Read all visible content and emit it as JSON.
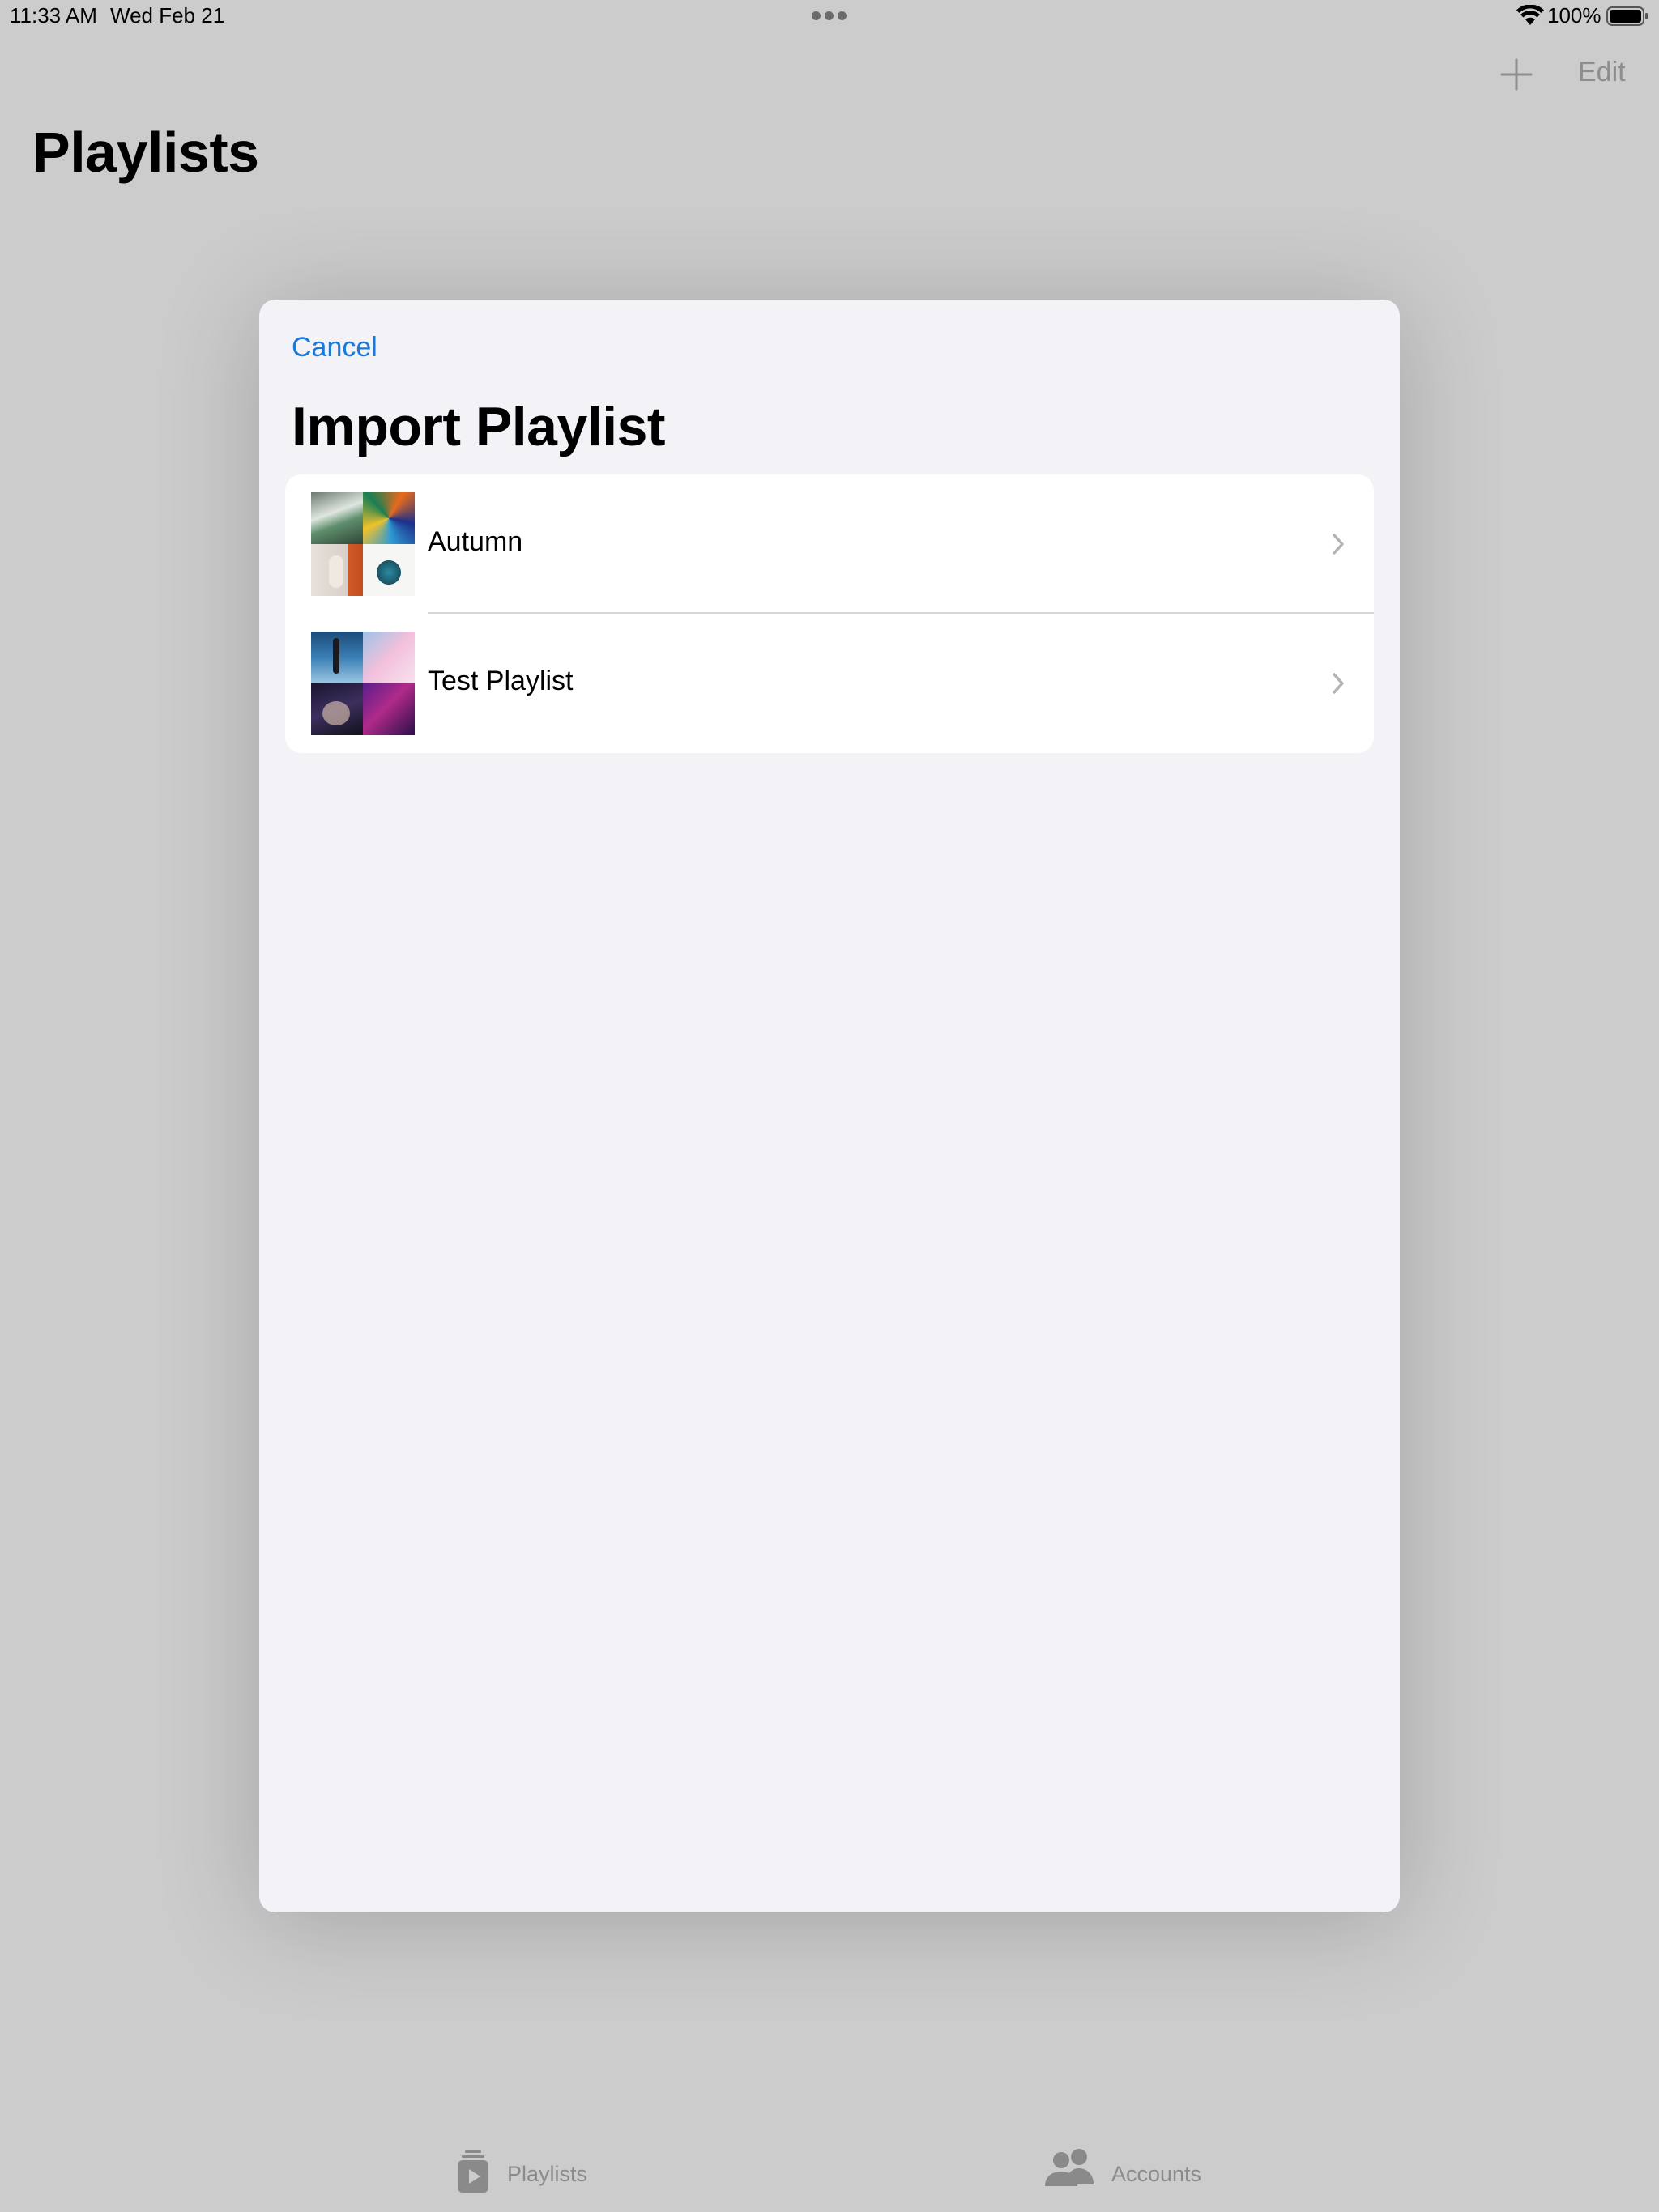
{
  "status_bar": {
    "time": "11:33 AM",
    "date": "Wed Feb 21",
    "battery": "100%"
  },
  "nav": {
    "edit_label": "Edit"
  },
  "page": {
    "title": "Playlists"
  },
  "modal": {
    "cancel_label": "Cancel",
    "title": "Import Playlist",
    "playlists": [
      {
        "name": "Autumn"
      },
      {
        "name": "Test Playlist"
      }
    ]
  },
  "tab_bar": {
    "tabs": [
      {
        "label": "Playlists",
        "icon": "playlist-icon"
      },
      {
        "label": "Accounts",
        "icon": "people-icon"
      }
    ]
  },
  "colors": {
    "accent": "#1a7ad9",
    "background": "#cccccc",
    "modal_background": "#f2f2f7"
  }
}
